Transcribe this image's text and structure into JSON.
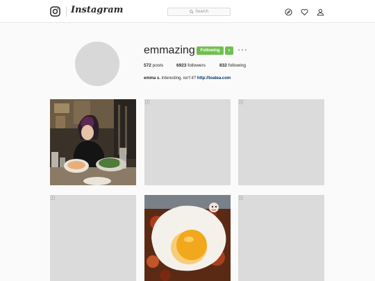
{
  "header": {
    "brand": "Instagram",
    "search_placeholder": "Search",
    "icons": [
      "instagram-logo-icon",
      "search-icon",
      "compass-icon",
      "heart-icon",
      "person-icon"
    ]
  },
  "profile": {
    "username": "emmazing",
    "follow_label": "Following",
    "dropdown_label": "▾",
    "posts_count": "572",
    "posts_label": "posts",
    "followers_count": "6923",
    "followers_label": "followers",
    "following_count": "832",
    "following_label": "following",
    "bio_name": "emma s.",
    "bio_text": "interesting, isn't it?",
    "bio_link": "http://toatea.com"
  },
  "colors": {
    "follow_button": "#70c050",
    "link": "#003569",
    "placeholder": "#dbdbdb"
  },
  "posts": [
    {
      "kind": "photo",
      "subject": "woman-eating-ramen"
    },
    {
      "kind": "broken-image"
    },
    {
      "kind": "broken-image"
    },
    {
      "kind": "broken-image"
    },
    {
      "kind": "photo",
      "subject": "fried-egg-on-kimchi-rice"
    },
    {
      "kind": "broken-image"
    }
  ]
}
